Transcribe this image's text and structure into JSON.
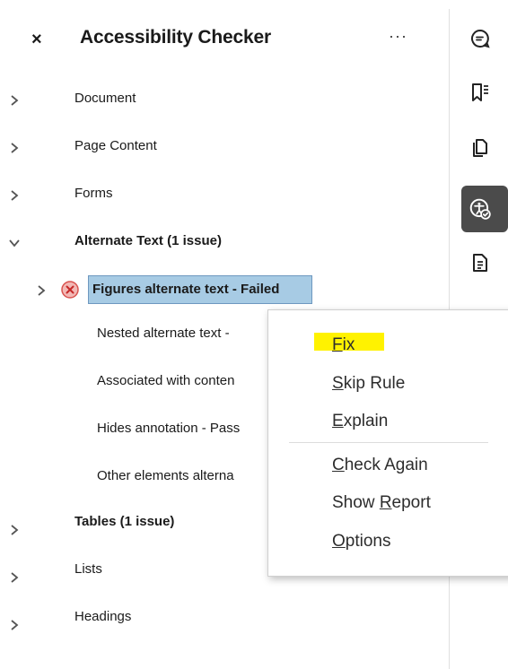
{
  "header": {
    "title": "Accessibility Checker",
    "close_glyph": "×",
    "more_glyph": "···"
  },
  "tree": {
    "document": "Document",
    "page_content": "Page Content",
    "forms": "Forms",
    "alternate_text": "Alternate Text (1 issue)",
    "figures_alt": "Figures alternate text - Failed",
    "nested_alt": "Nested alternate text - ",
    "associated": "Associated with conten",
    "hides_annotation": "Hides annotation - Pass",
    "other_elements": "Other elements alterna",
    "tables": "Tables (1 issue)",
    "lists": "Lists",
    "headings": "Headings"
  },
  "context_menu": {
    "fix": {
      "mnemonic": "F",
      "rest": "ix"
    },
    "skip_rule": {
      "mnemonic": "S",
      "rest": "kip Rule"
    },
    "explain": {
      "mnemonic": "E",
      "rest": "xplain"
    },
    "check_again": {
      "mnemonic": "C",
      "rest": "heck Again"
    },
    "show_report": {
      "before": "Show ",
      "mnemonic": "R",
      "rest": "eport"
    },
    "options": {
      "mnemonic": "O",
      "rest": "ptions"
    }
  },
  "icons": {
    "rail": [
      "comment-icon",
      "bookmark-list-icon",
      "pages-copy-icon",
      "accessibility-icon",
      "document-info-icon"
    ],
    "fail": "failed-x-icon",
    "collapsed": "chevron-right-icon",
    "expanded": "chevron-down-icon"
  },
  "colors": {
    "selection": "#a7cbe4",
    "fail_red": "#d9534f",
    "highlight": "#fff200",
    "rail_active": "#4b4b4b"
  }
}
